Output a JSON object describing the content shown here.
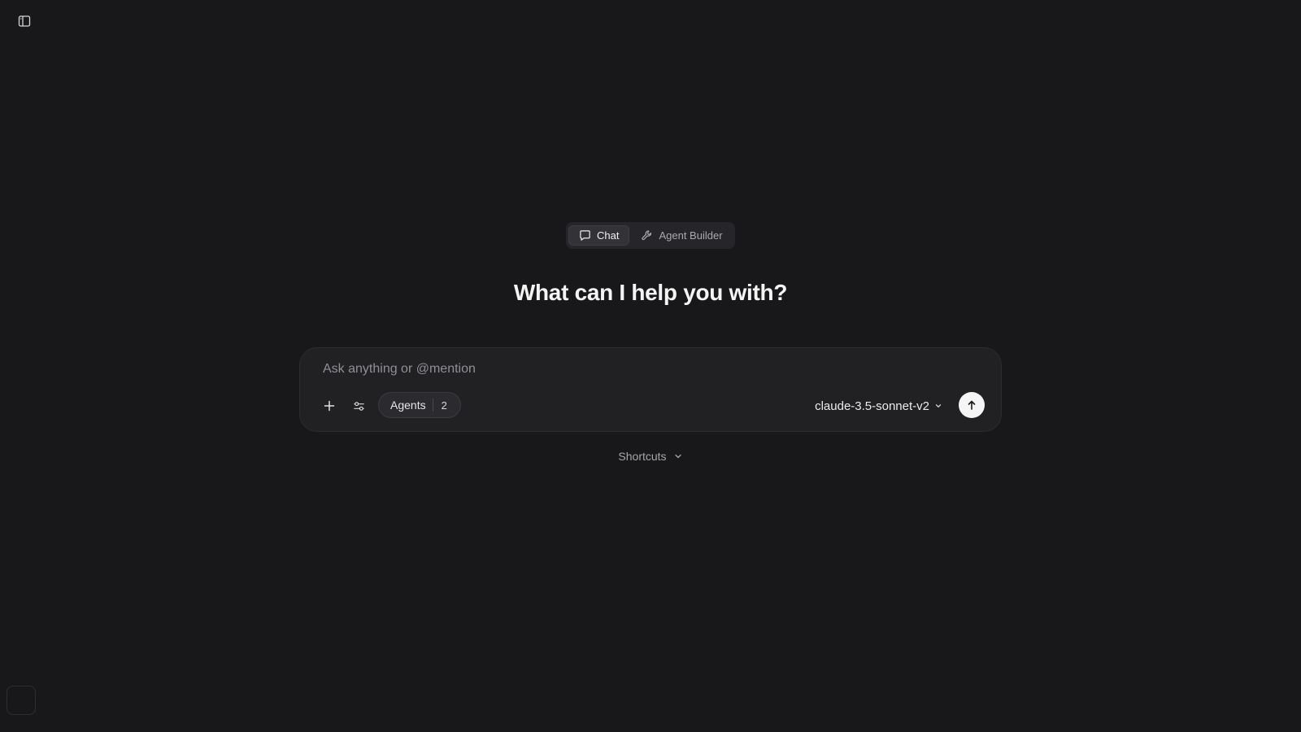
{
  "header": {
    "sidebar_toggle_icon": "sidebar-panel-icon"
  },
  "mode_switch": {
    "tabs": [
      {
        "label": "Chat",
        "icon": "chat-bubble-icon",
        "active": true
      },
      {
        "label": "Agent Builder",
        "icon": "wrench-icon",
        "active": false
      }
    ]
  },
  "main": {
    "headline": "What can I help you with?"
  },
  "composer": {
    "placeholder": "Ask anything or @mention",
    "value": "",
    "add_icon": "plus-icon",
    "settings_icon": "sliders-icon",
    "agents_label": "Agents",
    "agents_count": "2",
    "model": "claude-3.5-sonnet-v2",
    "send_icon": "arrow-up-icon"
  },
  "shortcuts": {
    "label": "Shortcuts"
  },
  "colors": {
    "background": "#18181a",
    "surface": "#212124",
    "send_button": "#f5f5f6"
  }
}
